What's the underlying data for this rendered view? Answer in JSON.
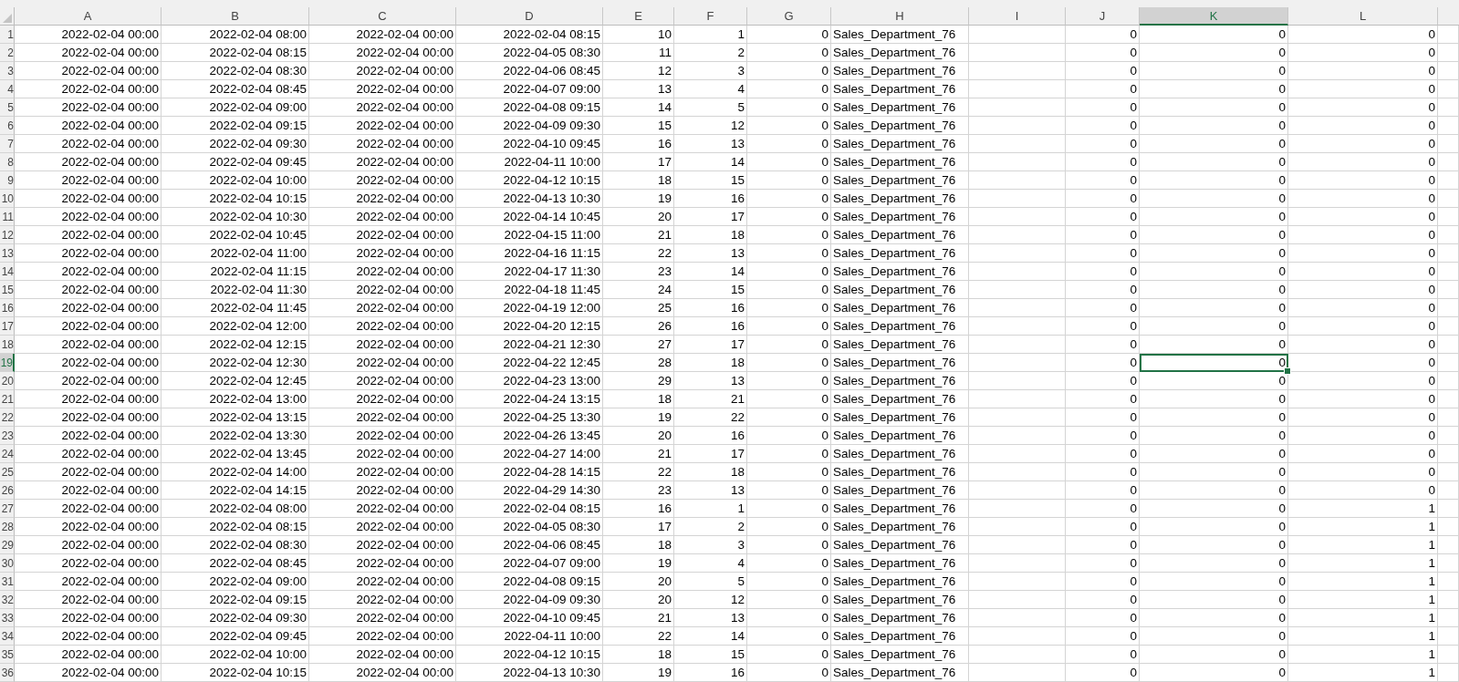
{
  "columns": [
    {
      "label": "A",
      "selected": false
    },
    {
      "label": "B",
      "selected": false
    },
    {
      "label": "C",
      "selected": false
    },
    {
      "label": "D",
      "selected": false
    },
    {
      "label": "E",
      "selected": false
    },
    {
      "label": "F",
      "selected": false
    },
    {
      "label": "G",
      "selected": false
    },
    {
      "label": "H",
      "selected": false
    },
    {
      "label": "I",
      "selected": false
    },
    {
      "label": "J",
      "selected": false
    },
    {
      "label": "K",
      "selected": true
    },
    {
      "label": "L",
      "selected": false
    }
  ],
  "rows": [
    {
      "number": "1",
      "selected": false,
      "cells": [
        "2022-02-04 00:00",
        "2022-02-04 08:00",
        "2022-02-04 00:00",
        "2022-02-04 08:15",
        "10",
        "1",
        "0",
        "Sales_Department_76",
        null,
        "0",
        "0",
        "0"
      ]
    },
    {
      "number": "2",
      "selected": false,
      "cells": [
        "2022-02-04 00:00",
        "2022-02-04 08:15",
        "2022-02-04 00:00",
        "2022-04-05 08:30",
        "11",
        "2",
        "0",
        "Sales_Department_76",
        null,
        "0",
        "0",
        "0"
      ]
    },
    {
      "number": "3",
      "selected": false,
      "cells": [
        "2022-02-04 00:00",
        "2022-02-04 08:30",
        "2022-02-04 00:00",
        "2022-04-06 08:45",
        "12",
        "3",
        "0",
        "Sales_Department_76",
        null,
        "0",
        "0",
        "0"
      ]
    },
    {
      "number": "4",
      "selected": false,
      "cells": [
        "2022-02-04 00:00",
        "2022-02-04 08:45",
        "2022-02-04 00:00",
        "2022-04-07 09:00",
        "13",
        "4",
        "0",
        "Sales_Department_76",
        null,
        "0",
        "0",
        "0"
      ]
    },
    {
      "number": "5",
      "selected": false,
      "cells": [
        "2022-02-04 00:00",
        "2022-02-04 09:00",
        "2022-02-04 00:00",
        "2022-04-08 09:15",
        "14",
        "5",
        "0",
        "Sales_Department_76",
        null,
        "0",
        "0",
        "0"
      ]
    },
    {
      "number": "6",
      "selected": false,
      "cells": [
        "2022-02-04 00:00",
        "2022-02-04 09:15",
        "2022-02-04 00:00",
        "2022-04-09 09:30",
        "15",
        "12",
        "0",
        "Sales_Department_76",
        null,
        "0",
        "0",
        "0"
      ]
    },
    {
      "number": "7",
      "selected": false,
      "cells": [
        "2022-02-04 00:00",
        "2022-02-04 09:30",
        "2022-02-04 00:00",
        "2022-04-10 09:45",
        "16",
        "13",
        "0",
        "Sales_Department_76",
        null,
        "0",
        "0",
        "0"
      ]
    },
    {
      "number": "8",
      "selected": false,
      "cells": [
        "2022-02-04 00:00",
        "2022-02-04 09:45",
        "2022-02-04 00:00",
        "2022-04-11 10:00",
        "17",
        "14",
        "0",
        "Sales_Department_76",
        null,
        "0",
        "0",
        "0"
      ]
    },
    {
      "number": "9",
      "selected": false,
      "cells": [
        "2022-02-04 00:00",
        "2022-02-04 10:00",
        "2022-02-04 00:00",
        "2022-04-12 10:15",
        "18",
        "15",
        "0",
        "Sales_Department_76",
        null,
        "0",
        "0",
        "0"
      ]
    },
    {
      "number": "10",
      "selected": false,
      "cells": [
        "2022-02-04 00:00",
        "2022-02-04 10:15",
        "2022-02-04 00:00",
        "2022-04-13 10:30",
        "19",
        "16",
        "0",
        "Sales_Department_76",
        null,
        "0",
        "0",
        "0"
      ]
    },
    {
      "number": "11",
      "selected": false,
      "cells": [
        "2022-02-04 00:00",
        "2022-02-04 10:30",
        "2022-02-04 00:00",
        "2022-04-14 10:45",
        "20",
        "17",
        "0",
        "Sales_Department_76",
        null,
        "0",
        "0",
        "0"
      ]
    },
    {
      "number": "12",
      "selected": false,
      "cells": [
        "2022-02-04 00:00",
        "2022-02-04 10:45",
        "2022-02-04 00:00",
        "2022-04-15 11:00",
        "21",
        "18",
        "0",
        "Sales_Department_76",
        null,
        "0",
        "0",
        "0"
      ]
    },
    {
      "number": "13",
      "selected": false,
      "cells": [
        "2022-02-04 00:00",
        "2022-02-04 11:00",
        "2022-02-04 00:00",
        "2022-04-16 11:15",
        "22",
        "13",
        "0",
        "Sales_Department_76",
        null,
        "0",
        "0",
        "0"
      ]
    },
    {
      "number": "14",
      "selected": false,
      "cells": [
        "2022-02-04 00:00",
        "2022-02-04 11:15",
        "2022-02-04 00:00",
        "2022-04-17 11:30",
        "23",
        "14",
        "0",
        "Sales_Department_76",
        null,
        "0",
        "0",
        "0"
      ]
    },
    {
      "number": "15",
      "selected": false,
      "cells": [
        "2022-02-04 00:00",
        "2022-02-04 11:30",
        "2022-02-04 00:00",
        "2022-04-18 11:45",
        "24",
        "15",
        "0",
        "Sales_Department_76",
        null,
        "0",
        "0",
        "0"
      ]
    },
    {
      "number": "16",
      "selected": false,
      "cells": [
        "2022-02-04 00:00",
        "2022-02-04 11:45",
        "2022-02-04 00:00",
        "2022-04-19 12:00",
        "25",
        "16",
        "0",
        "Sales_Department_76",
        null,
        "0",
        "0",
        "0"
      ]
    },
    {
      "number": "17",
      "selected": false,
      "cells": [
        "2022-02-04 00:00",
        "2022-02-04 12:00",
        "2022-02-04 00:00",
        "2022-04-20 12:15",
        "26",
        "16",
        "0",
        "Sales_Department_76",
        null,
        "0",
        "0",
        "0"
      ]
    },
    {
      "number": "18",
      "selected": false,
      "cells": [
        "2022-02-04 00:00",
        "2022-02-04 12:15",
        "2022-02-04 00:00",
        "2022-04-21 12:30",
        "27",
        "17",
        "0",
        "Sales_Department_76",
        null,
        "0",
        "0",
        "0"
      ]
    },
    {
      "number": "19",
      "selected": true,
      "cells": [
        "2022-02-04 00:00",
        "2022-02-04 12:30",
        "2022-02-04 00:00",
        "2022-04-22 12:45",
        "28",
        "18",
        "0",
        "Sales_Department_76",
        null,
        "0",
        "0",
        "0"
      ]
    },
    {
      "number": "20",
      "selected": false,
      "cells": [
        "2022-02-04 00:00",
        "2022-02-04 12:45",
        "2022-02-04 00:00",
        "2022-04-23 13:00",
        "29",
        "13",
        "0",
        "Sales_Department_76",
        null,
        "0",
        "0",
        "0"
      ]
    },
    {
      "number": "21",
      "selected": false,
      "cells": [
        "2022-02-04 00:00",
        "2022-02-04 13:00",
        "2022-02-04 00:00",
        "2022-04-24 13:15",
        "18",
        "21",
        "0",
        "Sales_Department_76",
        null,
        "0",
        "0",
        "0"
      ]
    },
    {
      "number": "22",
      "selected": false,
      "cells": [
        "2022-02-04 00:00",
        "2022-02-04 13:15",
        "2022-02-04 00:00",
        "2022-04-25 13:30",
        "19",
        "22",
        "0",
        "Sales_Department_76",
        null,
        "0",
        "0",
        "0"
      ]
    },
    {
      "number": "23",
      "selected": false,
      "cells": [
        "2022-02-04 00:00",
        "2022-02-04 13:30",
        "2022-02-04 00:00",
        "2022-04-26 13:45",
        "20",
        "16",
        "0",
        "Sales_Department_76",
        null,
        "0",
        "0",
        "0"
      ]
    },
    {
      "number": "24",
      "selected": false,
      "cells": [
        "2022-02-04 00:00",
        "2022-02-04 13:45",
        "2022-02-04 00:00",
        "2022-04-27 14:00",
        "21",
        "17",
        "0",
        "Sales_Department_76",
        null,
        "0",
        "0",
        "0"
      ]
    },
    {
      "number": "25",
      "selected": false,
      "cells": [
        "2022-02-04 00:00",
        "2022-02-04 14:00",
        "2022-02-04 00:00",
        "2022-04-28 14:15",
        "22",
        "18",
        "0",
        "Sales_Department_76",
        null,
        "0",
        "0",
        "0"
      ]
    },
    {
      "number": "26",
      "selected": false,
      "cells": [
        "2022-02-04 00:00",
        "2022-02-04 14:15",
        "2022-02-04 00:00",
        "2022-04-29 14:30",
        "23",
        "13",
        "0",
        "Sales_Department_76",
        null,
        "0",
        "0",
        "0"
      ]
    },
    {
      "number": "27",
      "selected": false,
      "cells": [
        "2022-02-04 00:00",
        "2022-02-04 08:00",
        "2022-02-04 00:00",
        "2022-02-04 08:15",
        "16",
        "1",
        "0",
        "Sales_Department_76",
        null,
        "0",
        "0",
        "1"
      ]
    },
    {
      "number": "28",
      "selected": false,
      "cells": [
        "2022-02-04 00:00",
        "2022-02-04 08:15",
        "2022-02-04 00:00",
        "2022-04-05 08:30",
        "17",
        "2",
        "0",
        "Sales_Department_76",
        null,
        "0",
        "0",
        "1"
      ]
    },
    {
      "number": "29",
      "selected": false,
      "cells": [
        "2022-02-04 00:00",
        "2022-02-04 08:30",
        "2022-02-04 00:00",
        "2022-04-06 08:45",
        "18",
        "3",
        "0",
        "Sales_Department_76",
        null,
        "0",
        "0",
        "1"
      ]
    },
    {
      "number": "30",
      "selected": false,
      "cells": [
        "2022-02-04 00:00",
        "2022-02-04 08:45",
        "2022-02-04 00:00",
        "2022-04-07 09:00",
        "19",
        "4",
        "0",
        "Sales_Department_76",
        null,
        "0",
        "0",
        "1"
      ]
    },
    {
      "number": "31",
      "selected": false,
      "cells": [
        "2022-02-04 00:00",
        "2022-02-04 09:00",
        "2022-02-04 00:00",
        "2022-04-08 09:15",
        "20",
        "5",
        "0",
        "Sales_Department_76",
        null,
        "0",
        "0",
        "1"
      ]
    },
    {
      "number": "32",
      "selected": false,
      "cells": [
        "2022-02-04 00:00",
        "2022-02-04 09:15",
        "2022-02-04 00:00",
        "2022-04-09 09:30",
        "20",
        "12",
        "0",
        "Sales_Department_76",
        null,
        "0",
        "0",
        "1"
      ]
    },
    {
      "number": "33",
      "selected": false,
      "cells": [
        "2022-02-04 00:00",
        "2022-02-04 09:30",
        "2022-02-04 00:00",
        "2022-04-10 09:45",
        "21",
        "13",
        "0",
        "Sales_Department_76",
        null,
        "0",
        "0",
        "1"
      ]
    },
    {
      "number": "34",
      "selected": false,
      "cells": [
        "2022-02-04 00:00",
        "2022-02-04 09:45",
        "2022-02-04 00:00",
        "2022-04-11 10:00",
        "22",
        "14",
        "0",
        "Sales_Department_76",
        null,
        "0",
        "0",
        "1"
      ]
    },
    {
      "number": "35",
      "selected": false,
      "cells": [
        "2022-02-04 00:00",
        "2022-02-04 10:00",
        "2022-02-04 00:00",
        "2022-04-12 10:15",
        "18",
        "15",
        "0",
        "Sales_Department_76",
        null,
        "0",
        "0",
        "1"
      ]
    },
    {
      "number": "36",
      "selected": false,
      "cells": [
        "2022-02-04 00:00",
        "2022-02-04 10:15",
        "2022-02-04 00:00",
        "2022-04-13 10:30",
        "19",
        "16",
        "0",
        "Sales_Department_76",
        null,
        "0",
        "0",
        "1"
      ]
    }
  ]
}
